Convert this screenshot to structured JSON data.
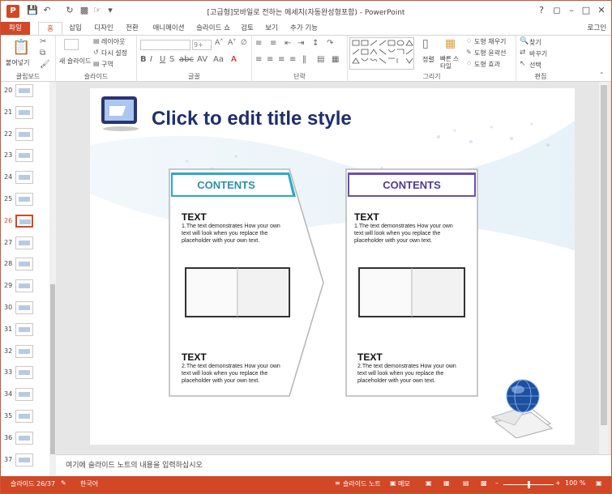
{
  "window": {
    "title": "[고급형]모바일로 전하는 메세지(자동완성형포함) - PowerPoint",
    "help": "?",
    "login": "로그인"
  },
  "tabs": [
    {
      "label": "파일"
    },
    {
      "label": "홈"
    },
    {
      "label": "삽입"
    },
    {
      "label": "디자인"
    },
    {
      "label": "전환"
    },
    {
      "label": "애니메이션"
    },
    {
      "label": "슬라이드 쇼"
    },
    {
      "label": "검토"
    },
    {
      "label": "보기"
    },
    {
      "label": "추가 기능"
    }
  ],
  "ribbon": {
    "clipboard": {
      "paste": "붙여넣기",
      "label": "클립보드"
    },
    "slides": {
      "new_slide": "새 슬라이드",
      "layout": "레이아웃",
      "reset": "다시 설정",
      "section": "구역",
      "label": "슬라이드"
    },
    "font": {
      "label": "글꼴",
      "size": "9+"
    },
    "paragraph": {
      "label": "단락"
    },
    "drawing": {
      "arrange": "정렬",
      "quick_styles": "빠른 스타일",
      "fill": "도형 채우기",
      "outline": "도형 윤곽선",
      "effects": "도형 효과",
      "label": "그리기"
    },
    "editing": {
      "find": "찾기",
      "replace": "바꾸기",
      "select": "선택",
      "label": "편집"
    }
  },
  "thumbnails": [
    {
      "num": "20"
    },
    {
      "num": "21"
    },
    {
      "num": "22"
    },
    {
      "num": "23"
    },
    {
      "num": "24"
    },
    {
      "num": "25"
    },
    {
      "num": "26"
    },
    {
      "num": "27"
    },
    {
      "num": "28"
    },
    {
      "num": "29"
    },
    {
      "num": "30"
    },
    {
      "num": "31"
    },
    {
      "num": "32"
    },
    {
      "num": "33"
    },
    {
      "num": "34"
    },
    {
      "num": "35"
    },
    {
      "num": "36"
    },
    {
      "num": "37"
    }
  ],
  "slide": {
    "title": "Click to edit title style",
    "cards": [
      {
        "header": "CONTENTS",
        "sections": [
          {
            "heading": "TEXT",
            "lines": [
              "1.The text demonstrates How your own",
              "text will look when you replace the",
              "placeholder with your own text."
            ]
          },
          {
            "heading": "TEXT",
            "lines": [
              "2.The text demonstrates How your own",
              "text will look when you replace the",
              "placeholder with your own text."
            ]
          }
        ]
      },
      {
        "header": "CONTENTS",
        "sections": [
          {
            "heading": "TEXT",
            "lines": [
              "1.The text demonstrates How your own",
              "text will look when you replace the",
              "placeholder with your own text."
            ]
          },
          {
            "heading": "TEXT",
            "lines": [
              "2.The text demonstrates How your own",
              "text will look when you replace the",
              "placeholder with your own text."
            ]
          }
        ]
      }
    ]
  },
  "notes": {
    "placeholder": "여기에 슬라이드 노트의 내용을 입력하십시오"
  },
  "status": {
    "slide_counter": "슬라이드 26/37",
    "language": "한국어",
    "notes_btn": "슬라이드 노트",
    "comments_btn": "메모",
    "zoom": "100 %"
  },
  "colors": {
    "accent": "#d24726",
    "title": "#1f2f6b",
    "teal": "#2aa9c9",
    "purple": "#6a4fb0"
  }
}
